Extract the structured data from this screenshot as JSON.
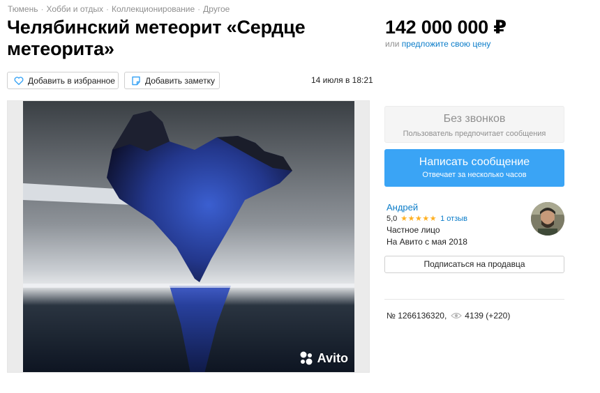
{
  "breadcrumbs": [
    "Тюмень",
    "Хобби и отдых",
    "Коллекционирование",
    "Другое"
  ],
  "title": "Челябинский метеорит «Сердце метеорита»",
  "price": {
    "amount": "142 000 000 ₽",
    "alt_prefix": "или",
    "alt_link": "предложите свою цену"
  },
  "actions": {
    "favorite_label": "Добавить в избранное",
    "note_label": "Добавить заметку"
  },
  "date": "14 июля в 18:21",
  "gallery": {
    "watermark": "Avito"
  },
  "contact": {
    "nocall_title": "Без звонков",
    "nocall_sub": "Пользователь предпочитает сообщения",
    "message_title": "Написать сообщение",
    "message_sub": "Отвечает за несколько часов"
  },
  "seller": {
    "name": "Андрей",
    "rating": "5,0",
    "stars": "★★★★★",
    "reviews": "1 отзыв",
    "type": "Частное лицо",
    "since": "На Авито с мая 2018",
    "subscribe_label": "Подписаться на продавца"
  },
  "listing": {
    "number": "№ 1266136320,",
    "views": "4139 (+220)"
  },
  "colors": {
    "accent": "#3aa4f5",
    "link": "#0a7cc9",
    "star": "#ffb021",
    "muted": "#8f8f8f"
  }
}
